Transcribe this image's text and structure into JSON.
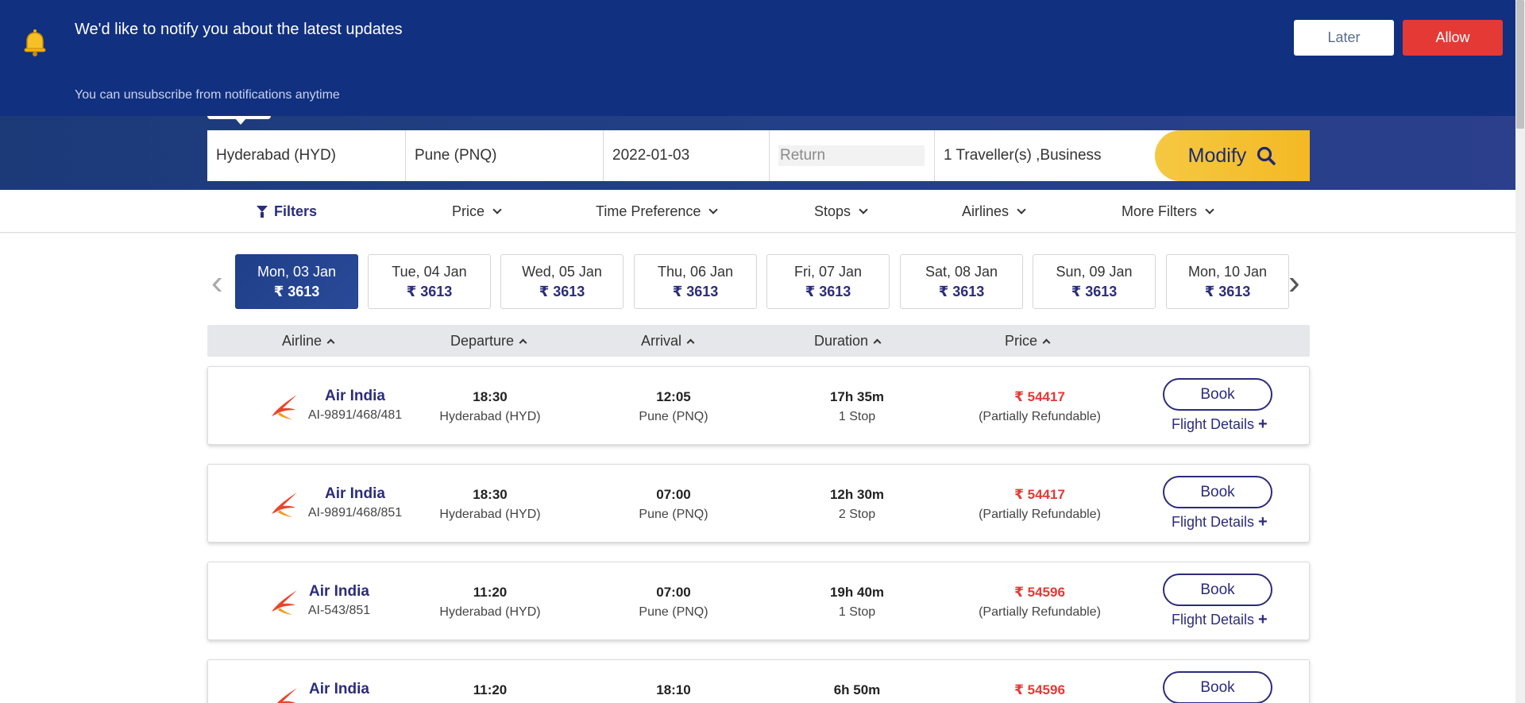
{
  "notification": {
    "title": "We'd like to notify you about the latest updates",
    "subtitle": "You can unsubscribe from notifications anytime",
    "later_label": "Later",
    "allow_label": "Allow"
  },
  "search": {
    "from": "Hyderabad (HYD)",
    "to": "Pune (PNQ)",
    "date": "2022-01-03",
    "return_placeholder": "Return",
    "travellers": "1  Traveller(s) ,Business",
    "modify_label": "Modify"
  },
  "filters": {
    "main_label": "Filters",
    "items": [
      "Price",
      "Time Preference",
      "Stops",
      "Airlines",
      "More Filters"
    ]
  },
  "dates": [
    {
      "day": "Mon, 03 Jan",
      "price": "₹ 3613",
      "active": true
    },
    {
      "day": "Tue, 04 Jan",
      "price": "₹ 3613"
    },
    {
      "day": "Wed, 05 Jan",
      "price": "₹ 3613"
    },
    {
      "day": "Thu, 06 Jan",
      "price": "₹ 3613"
    },
    {
      "day": "Fri, 07 Jan",
      "price": "₹ 3613"
    },
    {
      "day": "Sat, 08 Jan",
      "price": "₹ 3613"
    },
    {
      "day": "Sun, 09 Jan",
      "price": "₹ 3613"
    },
    {
      "day": "Mon, 10 Jan",
      "price": "₹ 3613"
    }
  ],
  "sort_headers": [
    "Airline",
    "Departure",
    "Arrival",
    "Duration",
    "Price"
  ],
  "flights": [
    {
      "airline": "Air India",
      "code": "AI-9891/468/481",
      "dep_time": "18:30",
      "dep_city": "Hyderabad (HYD)",
      "arr_time": "12:05",
      "arr_city": "Pune (PNQ)",
      "duration": "17h 35m",
      "stops": "1 Stop",
      "price": "₹ 54417",
      "refund": "(Partially Refundable)",
      "book_label": "Book",
      "details_label": "Flight Details",
      "plus": "+"
    },
    {
      "airline": "Air India",
      "code": "AI-9891/468/851",
      "dep_time": "18:30",
      "dep_city": "Hyderabad (HYD)",
      "arr_time": "07:00",
      "arr_city": "Pune (PNQ)",
      "duration": "12h 30m",
      "stops": "2 Stop",
      "price": "₹ 54417",
      "refund": "(Partially Refundable)",
      "book_label": "Book",
      "details_label": "Flight Details",
      "plus": "+"
    },
    {
      "airline": "Air India",
      "code": "AI-543/851",
      "dep_time": "11:20",
      "dep_city": "Hyderabad (HYD)",
      "arr_time": "07:00",
      "arr_city": "Pune (PNQ)",
      "duration": "19h 40m",
      "stops": "1 Stop",
      "price": "₹ 54596",
      "refund": "(Partially Refundable)",
      "book_label": "Book",
      "details_label": "Flight Details",
      "plus": "+"
    },
    {
      "airline": "Air India",
      "code": "",
      "dep_time": "11:20",
      "dep_city": "",
      "arr_time": "18:10",
      "arr_city": "",
      "duration": "6h 50m",
      "stops": "",
      "price": "₹ 54596",
      "refund": "",
      "book_label": "Book",
      "details_label": "",
      "plus": ""
    }
  ],
  "colors": {
    "brand_navy": "#11307f",
    "accent_yellow": "#f5c842",
    "price_red": "#e53935",
    "link_indigo": "#2b2c7c"
  },
  "icons": {
    "bell": "bell-icon",
    "search": "search-icon",
    "filter": "filter-icon",
    "airline_logo": "air-india-logo-icon"
  }
}
